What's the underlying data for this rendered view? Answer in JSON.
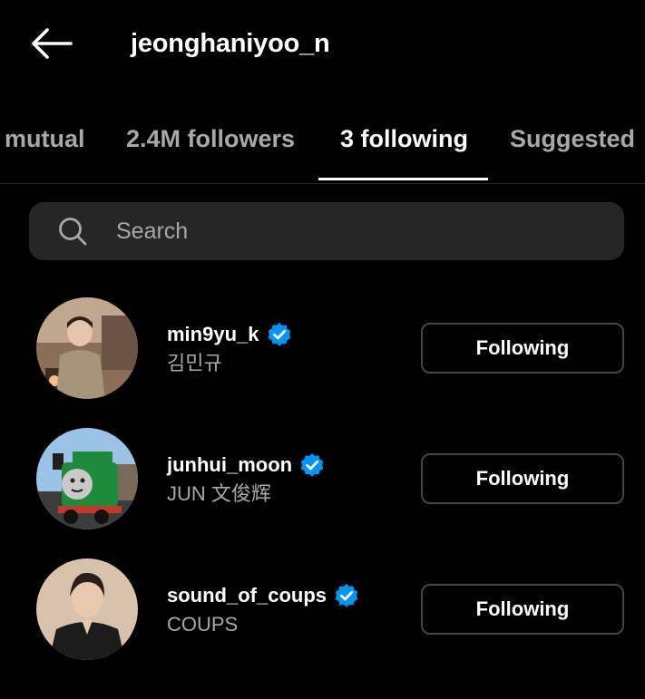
{
  "header": {
    "username": "jeonghaniyoo_n",
    "back_icon": "arrow-left-icon"
  },
  "tabs": [
    {
      "label": "mutual",
      "active": false
    },
    {
      "label": "2.4M followers",
      "active": false
    },
    {
      "label": "3 following",
      "active": true
    },
    {
      "label": "Suggested",
      "active": false
    }
  ],
  "search": {
    "placeholder": "Search",
    "value": "",
    "icon": "search-icon"
  },
  "following": [
    {
      "handle": "min9yu_k",
      "name": "김민규",
      "verified": true,
      "button_label": "Following"
    },
    {
      "handle": "junhui_moon",
      "name": "JUN 文俊辉",
      "verified": true,
      "button_label": "Following"
    },
    {
      "handle": "sound_of_coups",
      "name": "COUPS",
      "verified": true,
      "button_label": "Following"
    }
  ],
  "colors": {
    "background": "#000000",
    "text_primary": "#ffffff",
    "text_secondary": "#a8a8a8",
    "search_bg": "#262626",
    "verified_blue": "#0095f6",
    "button_border": "#474747"
  }
}
